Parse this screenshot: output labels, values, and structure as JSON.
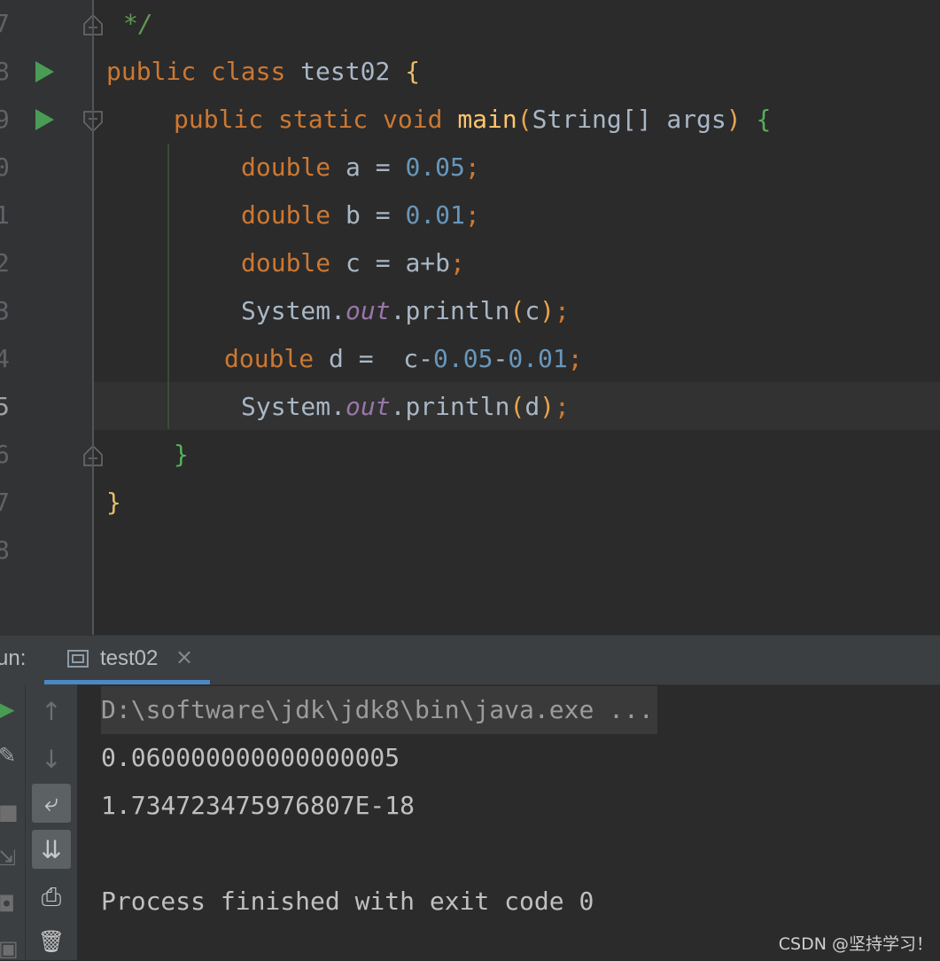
{
  "editor": {
    "line_numbers": [
      "7",
      "8",
      "9",
      "0",
      "1",
      "2",
      "3",
      "4",
      "5",
      "6",
      "7",
      "8"
    ],
    "code": {
      "l7_comment": "*/",
      "l8_public": "public",
      "l8_class": "class",
      "l8_name": "test02",
      "l8_brace": "{",
      "l9_public": "public",
      "l9_static": "static",
      "l9_void": "void",
      "l9_method": "main",
      "l9_paren_open": "(",
      "l9_params": "String[] args",
      "l9_paren_close": ")",
      "l9_brace": "{",
      "l10_type": "double",
      "l10_rest": "a = ",
      "l10_num": "0.05",
      "l10_semi": ";",
      "l11_type": "double",
      "l11_rest": "b = ",
      "l11_num": "0.01",
      "l11_semi": ";",
      "l12_type": "double",
      "l12_rest": "c = a+b",
      "l12_semi": ";",
      "l13_system": "System.",
      "l13_field": "out",
      "l13_call": ".println",
      "l13_open": "(",
      "l13_arg": "c",
      "l13_close": ")",
      "l13_semi": ";",
      "l14_type": "double",
      "l14_rest": "d =  c-",
      "l14_num1": "0.05",
      "l14_minus": "-",
      "l14_num2": "0.01",
      "l14_semi": ";",
      "l15_system": "System.",
      "l15_field": "out",
      "l15_call": ".println",
      "l15_open": "(",
      "l15_arg": "d",
      "l15_close": ")",
      "l15_semi": ";",
      "l16_brace": "}",
      "l17_brace": "}"
    }
  },
  "run_panel": {
    "title": "un:",
    "tab_label": "test02",
    "tab_close": "×",
    "console_lines": {
      "command": "D:\\software\\jdk\\jdk8\\bin\\java.exe ...",
      "output_c": "0.060000000000000005",
      "output_d": "1.734723475976807E-18",
      "finished": "Process finished with exit code 0"
    }
  },
  "watermark": "CSDN @坚持学习！",
  "icons": {
    "rerun": "▶",
    "settings": "✎",
    "stop": "■",
    "layout": "⇲",
    "camera": "◘",
    "pin": "▣",
    "up": "↑",
    "down": "↓",
    "soft_wrap": "⤶",
    "scroll_end": "⇊",
    "print": "⎙",
    "trash": "🗑"
  },
  "colors": {
    "keyword": "#cc7832",
    "number": "#6897bb",
    "field": "#9876aa",
    "method": "#ffc66d",
    "comment": "#629755",
    "run_marker": "#499c54",
    "tab_underline": "#4a88c7"
  }
}
